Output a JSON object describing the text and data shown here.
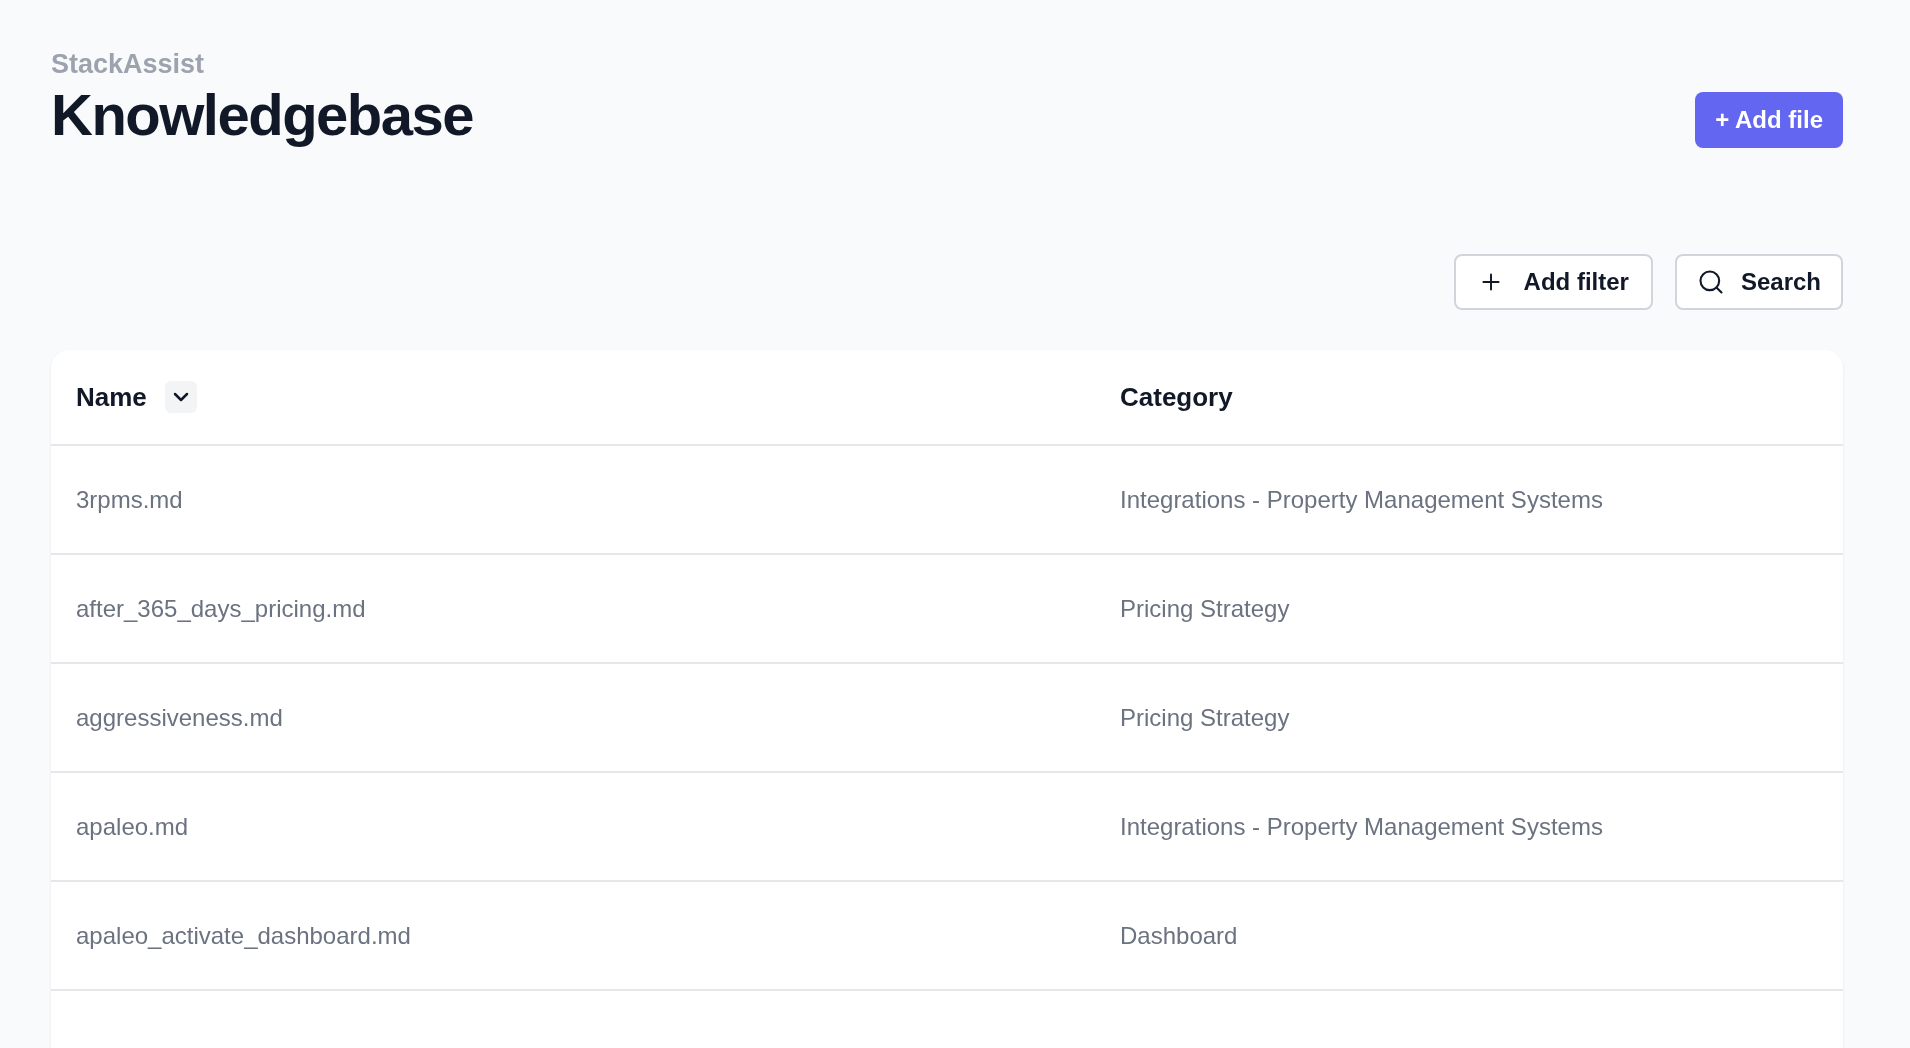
{
  "header": {
    "app_name": "StackAssist",
    "title": "Knowledgebase",
    "add_button": "+ Add file"
  },
  "toolbar": {
    "filter_button": "Add filter",
    "search_button": "Search"
  },
  "table": {
    "columns": [
      {
        "label": "Name",
        "sortable": true
      },
      {
        "label": "Category",
        "sortable": false
      }
    ],
    "rows": [
      {
        "name": "3rpms.md",
        "category": "Integrations - Property Management Systems"
      },
      {
        "name": "after_365_days_pricing.md",
        "category": "Pricing Strategy"
      },
      {
        "name": "aggressiveness.md",
        "category": "Pricing Strategy"
      },
      {
        "name": "apaleo.md",
        "category": "Integrations - Property Management Systems"
      },
      {
        "name": "apaleo_activate_dashboard.md",
        "category": "Dashboard"
      }
    ]
  }
}
